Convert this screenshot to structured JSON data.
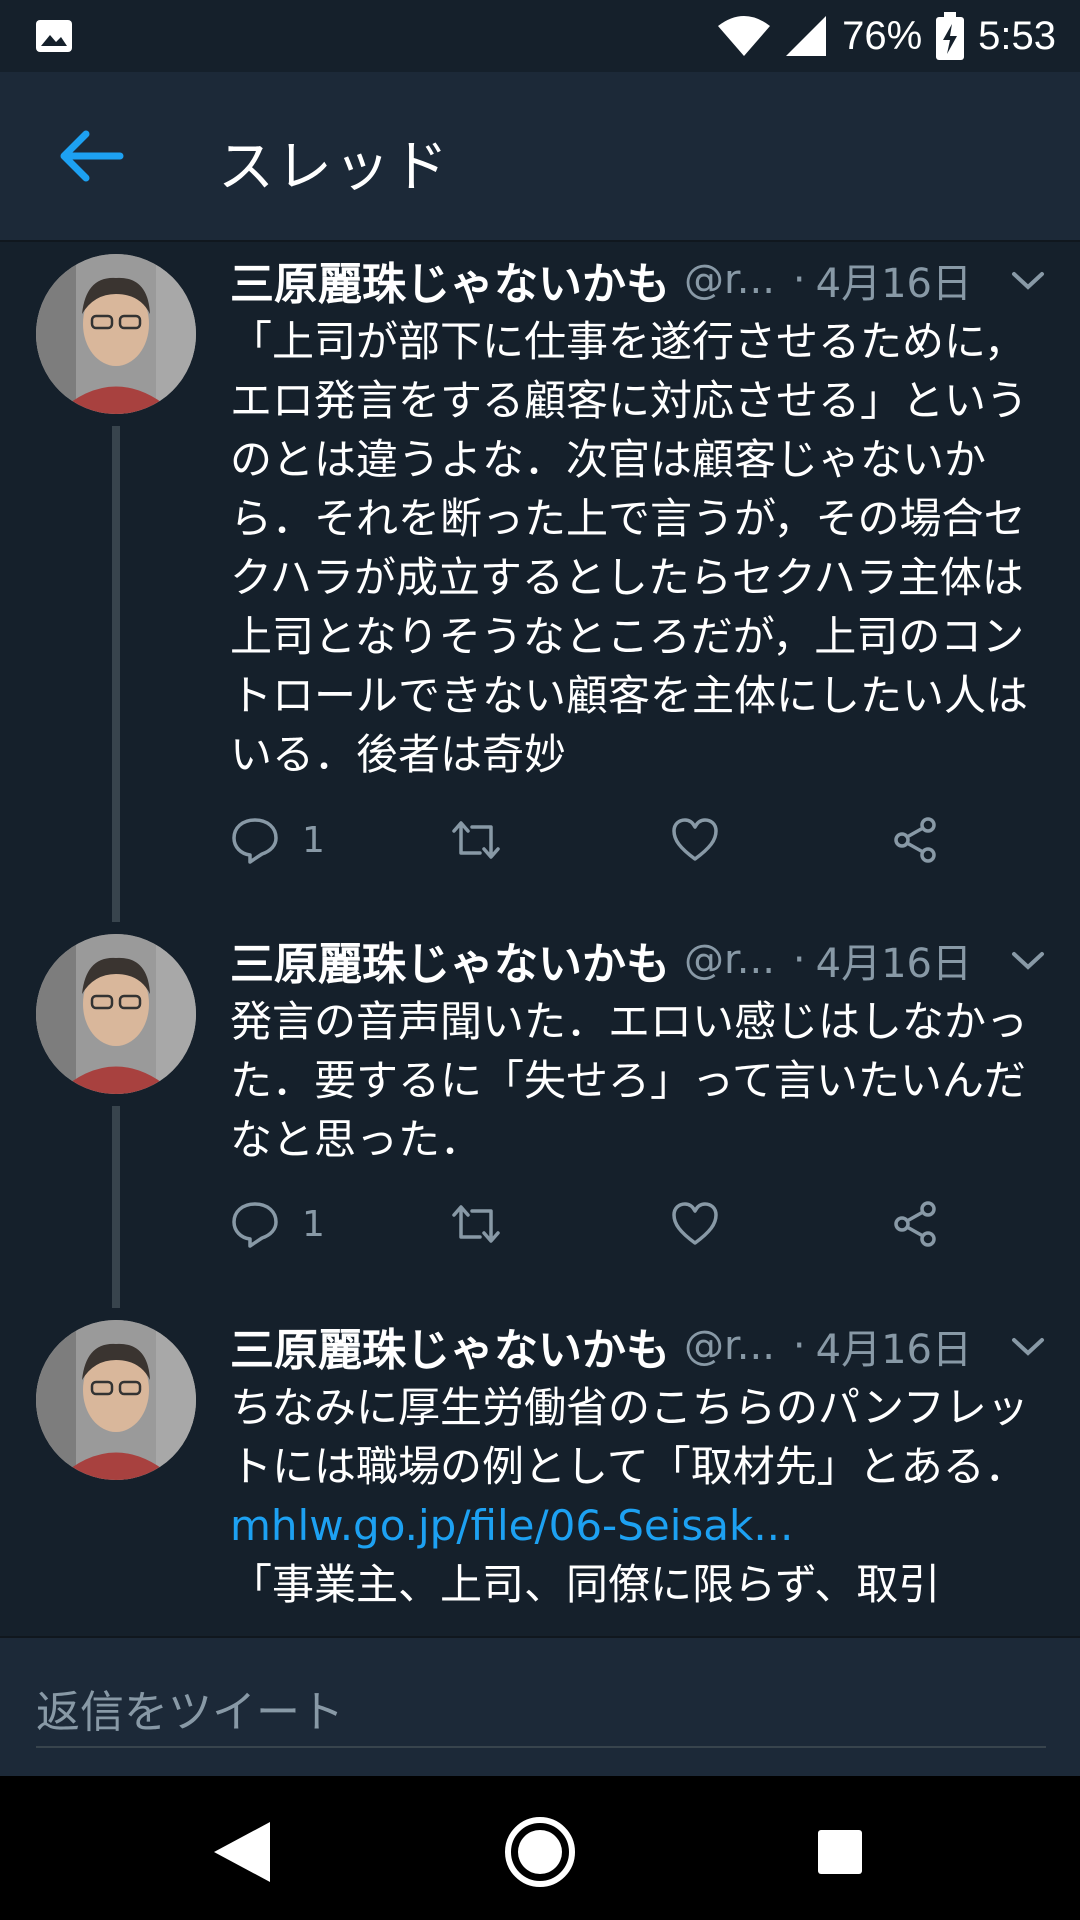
{
  "status_bar": {
    "battery": "76%",
    "time": "5:53"
  },
  "header": {
    "title": "スレッド"
  },
  "tweets": [
    {
      "name": "三原麗珠じゃないかも",
      "handle": "@r...",
      "sep": "·",
      "date": "4月16日",
      "text": "「上司が部下に仕事を遂行させるために，エロ発言をする顧客に対応させる」というのとは違うよな．次官は顧客じゃないから．それを断った上で言うが，その場合セクハラが成立するとしたらセクハラ主体は上司となりそうなところだが，上司のコントロールできない顧客を主体にしたい人はいる．後者は奇妙",
      "reply_count": "1"
    },
    {
      "name": "三原麗珠じゃないかも",
      "handle": "@r...",
      "sep": "·",
      "date": "4月16日",
      "text": "発言の音声聞いた．エロい感じはしなかった．要するに「失せろ」って言いたいんだなと思った．",
      "reply_count": "1"
    },
    {
      "name": "三原麗珠じゃないかも",
      "handle": "@r...",
      "sep": "·",
      "date": "4月16日",
      "text": "ちなみに厚生労働省のこちらのパンフレットには職場の例として「取材先」とある．",
      "link": "mhlw.go.jp/file/06-Seisak...",
      "text_after": "「事業主、上司、同僚に限らず、取引"
    }
  ],
  "composer": {
    "placeholder": "返信をツイート"
  },
  "colors": {
    "background": "#15202b",
    "header": "#1c2938",
    "accent": "#1da1f2",
    "muted": "#8899a6"
  },
  "icons": [
    "image-icon",
    "wifi-icon",
    "signal-icon",
    "battery-charging-icon",
    "back-arrow-icon",
    "reply-icon",
    "retweet-icon",
    "like-icon",
    "share-icon",
    "chevron-down-icon",
    "nav-back-icon",
    "nav-home-icon",
    "nav-recents-icon"
  ]
}
